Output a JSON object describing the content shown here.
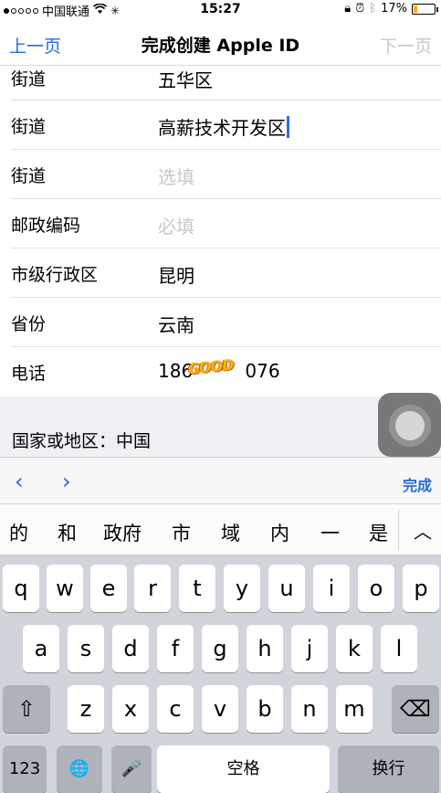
{
  "status": {
    "carrier": "中国联通",
    "time": "15:27",
    "battery": "17%",
    "battery_level": 0.17
  },
  "nav": {
    "prev": "上一页",
    "title": "完成创建 Apple ID",
    "next": "下一页"
  },
  "form": {
    "rows": [
      {
        "label": "街道",
        "value": "五华区"
      },
      {
        "label": "街道",
        "value": "高薪技术开发区"
      },
      {
        "label": "街道",
        "placeholder": "选填"
      },
      {
        "label": "邮政编码",
        "placeholder": "必填"
      },
      {
        "label": "市级行政区",
        "value": "昆明"
      },
      {
        "label": "省份",
        "value": "云南"
      },
      {
        "label": "电话",
        "value": "186         076"
      }
    ],
    "region": "国家或地区：中国"
  },
  "overlay_text": "GOOD",
  "toolbar": {
    "prev_icon": "‹",
    "next_icon": "›",
    "done": "完成"
  },
  "candidates": [
    "的",
    "和",
    "政府",
    "市",
    "域",
    "内",
    "一",
    "是"
  ],
  "keyboard": {
    "row1": [
      "q",
      "w",
      "e",
      "r",
      "t",
      "y",
      "u",
      "i",
      "o",
      "p"
    ],
    "row2": [
      "a",
      "s",
      "d",
      "f",
      "g",
      "h",
      "j",
      "k",
      "l"
    ],
    "row3": [
      "z",
      "x",
      "c",
      "v",
      "b",
      "n",
      "m"
    ],
    "shift": "⇧",
    "backspace": "⌫",
    "numbers": "123",
    "globe": "🌐",
    "mic": "🎤",
    "space": "空格",
    "return": "换行"
  }
}
